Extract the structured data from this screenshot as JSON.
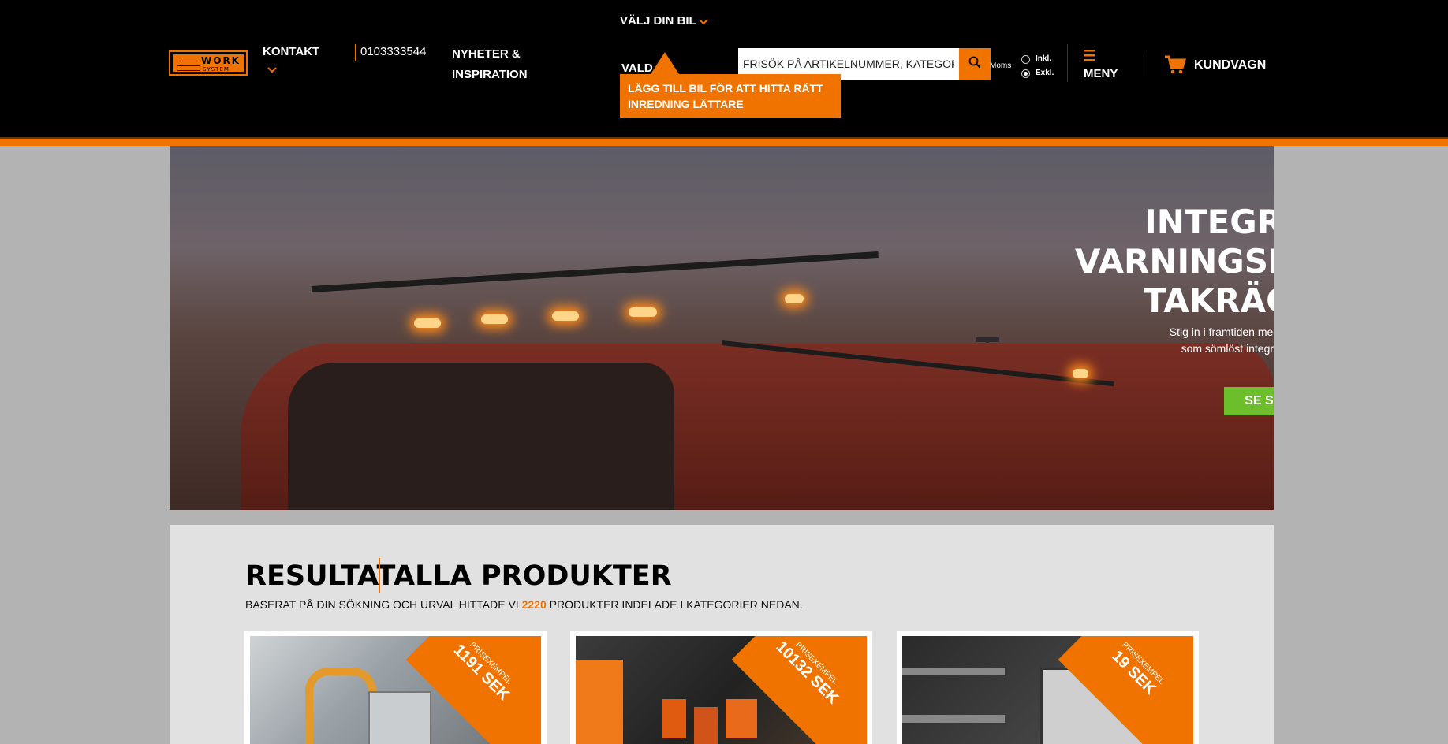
{
  "header": {
    "logo_text": "WORK",
    "logo_sub": "SYSTEM",
    "kontakt": "KONTAKT",
    "phone": "0103333544",
    "nyheter": "NYHETER & INSPIRATION",
    "valj_din_bil": "VÄLJ DIN BIL",
    "valj_bg": "VALD",
    "tooltip": "LÄGG TILL BIL FÖR ATT HITTA RÄTT INREDNING LÄTTARE",
    "search_placeholder": "FRISÖK PÅ ARTIKELNUMMER, KATEGORIER",
    "moms_label": "Moms",
    "moms_options": [
      "Inkl.",
      "Exkl."
    ],
    "moms_selected": "Exkl.",
    "menu": "MENY",
    "cart": "KUNDVAGN"
  },
  "hero": {
    "title": "INTEGRERAT VARNINGSLJUS I TAKRÄCKET!",
    "subtitle_line1": "Stig in i framtiden med nya WORK FLARE",
    "subtitle_line2": "som sömlöst integreras i våra takräcken",
    "cta": "SE SORTIMENTET"
  },
  "results": {
    "title": "RESULTAT",
    "title2": "ALLA PRODUKTER",
    "desc_before": "BASERAT PÅ DIN SÖKNING OCH URVAL HITTADE VI",
    "count": "2220",
    "desc_after": "PRODUKTER INDELADE I KATEGORIER NEDAN.",
    "cards": [
      {
        "label": "PRISEXEMPEL",
        "price": "1191 SEK"
      },
      {
        "label": "PRISEXEMPEL",
        "price": "10132 SEK"
      },
      {
        "label": "PRISEXEMPEL",
        "price": "19 SEK"
      }
    ]
  },
  "colors": {
    "accent": "#f07300",
    "cta_green": "#6cbe2a",
    "header_bg": "#000000",
    "page_bg": "#b3b3b3",
    "panel_bg": "#e1e1e1"
  }
}
